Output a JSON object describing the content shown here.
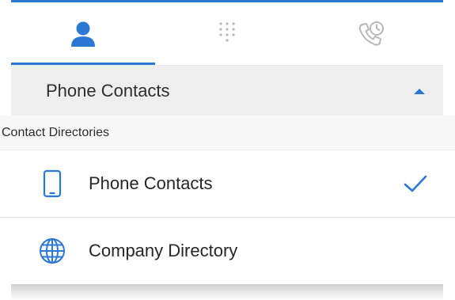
{
  "tabs": [
    {
      "icon": "person-icon",
      "active": true
    },
    {
      "icon": "dialpad-icon",
      "active": false
    },
    {
      "icon": "call-history-icon",
      "active": false
    }
  ],
  "selector": {
    "label": "Phone Contacts",
    "caret_icon": "caret-up-icon"
  },
  "directory_list": {
    "header": "Contact Directories",
    "items": [
      {
        "label": "Phone Contacts",
        "icon": "smartphone-icon",
        "selected": true
      },
      {
        "label": "Company Directory",
        "icon": "globe-icon",
        "selected": false
      }
    ]
  },
  "colors": {
    "accent": "#2b78d4",
    "inactive_icon": "#b8b8b8",
    "selector_bg": "#eeeeee",
    "header_bg": "#f7f7f7"
  }
}
